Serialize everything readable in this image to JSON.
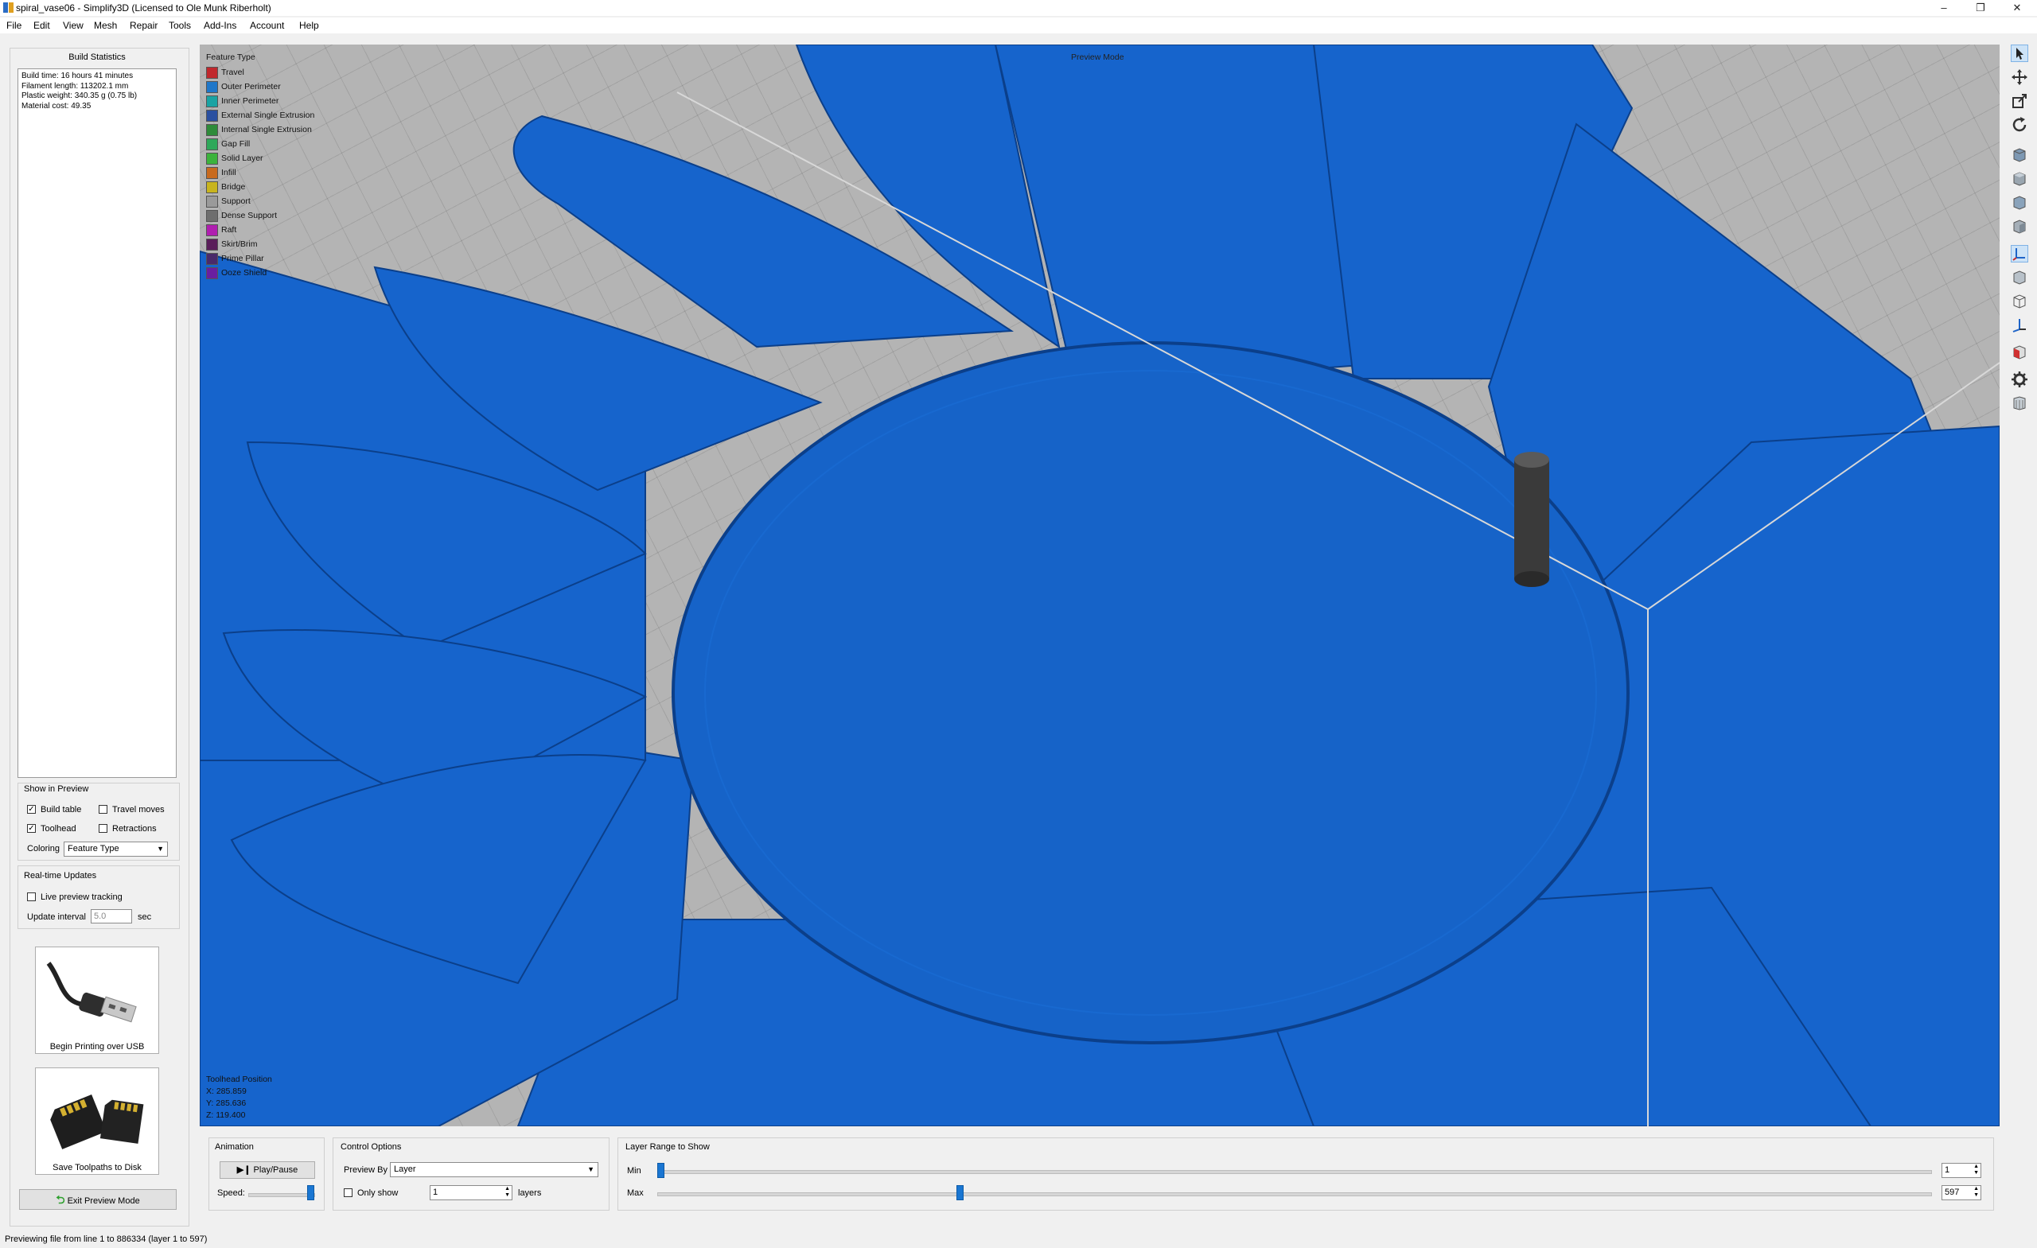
{
  "window": {
    "title": "spiral_vase06 - Simplify3D (Licensed to Ole Munk Riberholt)",
    "controls": {
      "minimize": "–",
      "restore": "❐",
      "close": "✕"
    }
  },
  "menu": [
    "File",
    "Edit",
    "View",
    "Mesh",
    "Repair",
    "Tools",
    "Add-Ins",
    "Account",
    "Help"
  ],
  "build_statistics": {
    "title": "Build Statistics",
    "lines": [
      "Build time: 16 hours 41 minutes",
      "Filament length: 113202.1 mm",
      "Plastic weight: 340.35 g (0.75 lb)",
      "Material cost: 49.35"
    ]
  },
  "show_in_preview": {
    "title": "Show in Preview",
    "build_table": {
      "label": "Build table",
      "checked": true
    },
    "travel_moves": {
      "label": "Travel moves",
      "checked": false
    },
    "toolhead": {
      "label": "Toolhead",
      "checked": true
    },
    "retractions": {
      "label": "Retractions",
      "checked": false
    },
    "coloring_label": "Coloring",
    "coloring_value": "Feature Type"
  },
  "realtime_updates": {
    "title": "Real-time Updates",
    "live_tracking": {
      "label": "Live preview tracking",
      "checked": false
    },
    "interval_label": "Update interval",
    "interval_value": "5.0",
    "interval_unit": "sec"
  },
  "usb_button": {
    "label": "Begin Printing over USB"
  },
  "sd_button": {
    "label": "Save Toolpaths to Disk"
  },
  "exit_preview": {
    "label": "Exit Preview Mode"
  },
  "viewport": {
    "mode_label": "Preview Mode",
    "legend_title": "Feature Type",
    "legend": [
      {
        "name": "Travel",
        "color": "#c0282d"
      },
      {
        "name": "Outer Perimeter",
        "color": "#1f77c9"
      },
      {
        "name": "Inner Perimeter",
        "color": "#1aa3a3"
      },
      {
        "name": "External Single Extrusion",
        "color": "#2a4fa0"
      },
      {
        "name": "Internal Single Extrusion",
        "color": "#2e8b3a"
      },
      {
        "name": "Gap Fill",
        "color": "#2ea85a"
      },
      {
        "name": "Solid Layer",
        "color": "#3cb33c"
      },
      {
        "name": "Infill",
        "color": "#c86a1e"
      },
      {
        "name": "Bridge",
        "color": "#c8b41e"
      },
      {
        "name": "Support",
        "color": "#9a9a9a"
      },
      {
        "name": "Dense Support",
        "color": "#6e6e6e"
      },
      {
        "name": "Raft",
        "color": "#b01eb0"
      },
      {
        "name": "Skirt/Brim",
        "color": "#5a1e5a"
      },
      {
        "name": "Prime Pillar",
        "color": "#4a2a6a"
      },
      {
        "name": "Ooze Shield",
        "color": "#6a1ea0"
      }
    ],
    "toolhead_position": {
      "title": "Toolhead Position",
      "x": "X: 285.859",
      "y": "Y: 285.636",
      "z": "Z: 119.400"
    },
    "model_color": "#1a6fd8"
  },
  "animation": {
    "title": "Animation",
    "play_label": "Play/Pause",
    "speed_label": "Speed:"
  },
  "control_options": {
    "title": "Control Options",
    "preview_by_label": "Preview By",
    "preview_by_value": "Layer",
    "only_show_label": "Only show",
    "only_show_checked": false,
    "only_show_value": "1",
    "layers_label": "layers"
  },
  "layer_range": {
    "title": "Layer Range to Show",
    "min_label": "Min",
    "max_label": "Max",
    "min_value": "1",
    "max_value": "597",
    "total_layers": 597
  },
  "status": "Previewing file from line 1 to 886334 (layer 1 to 597)"
}
